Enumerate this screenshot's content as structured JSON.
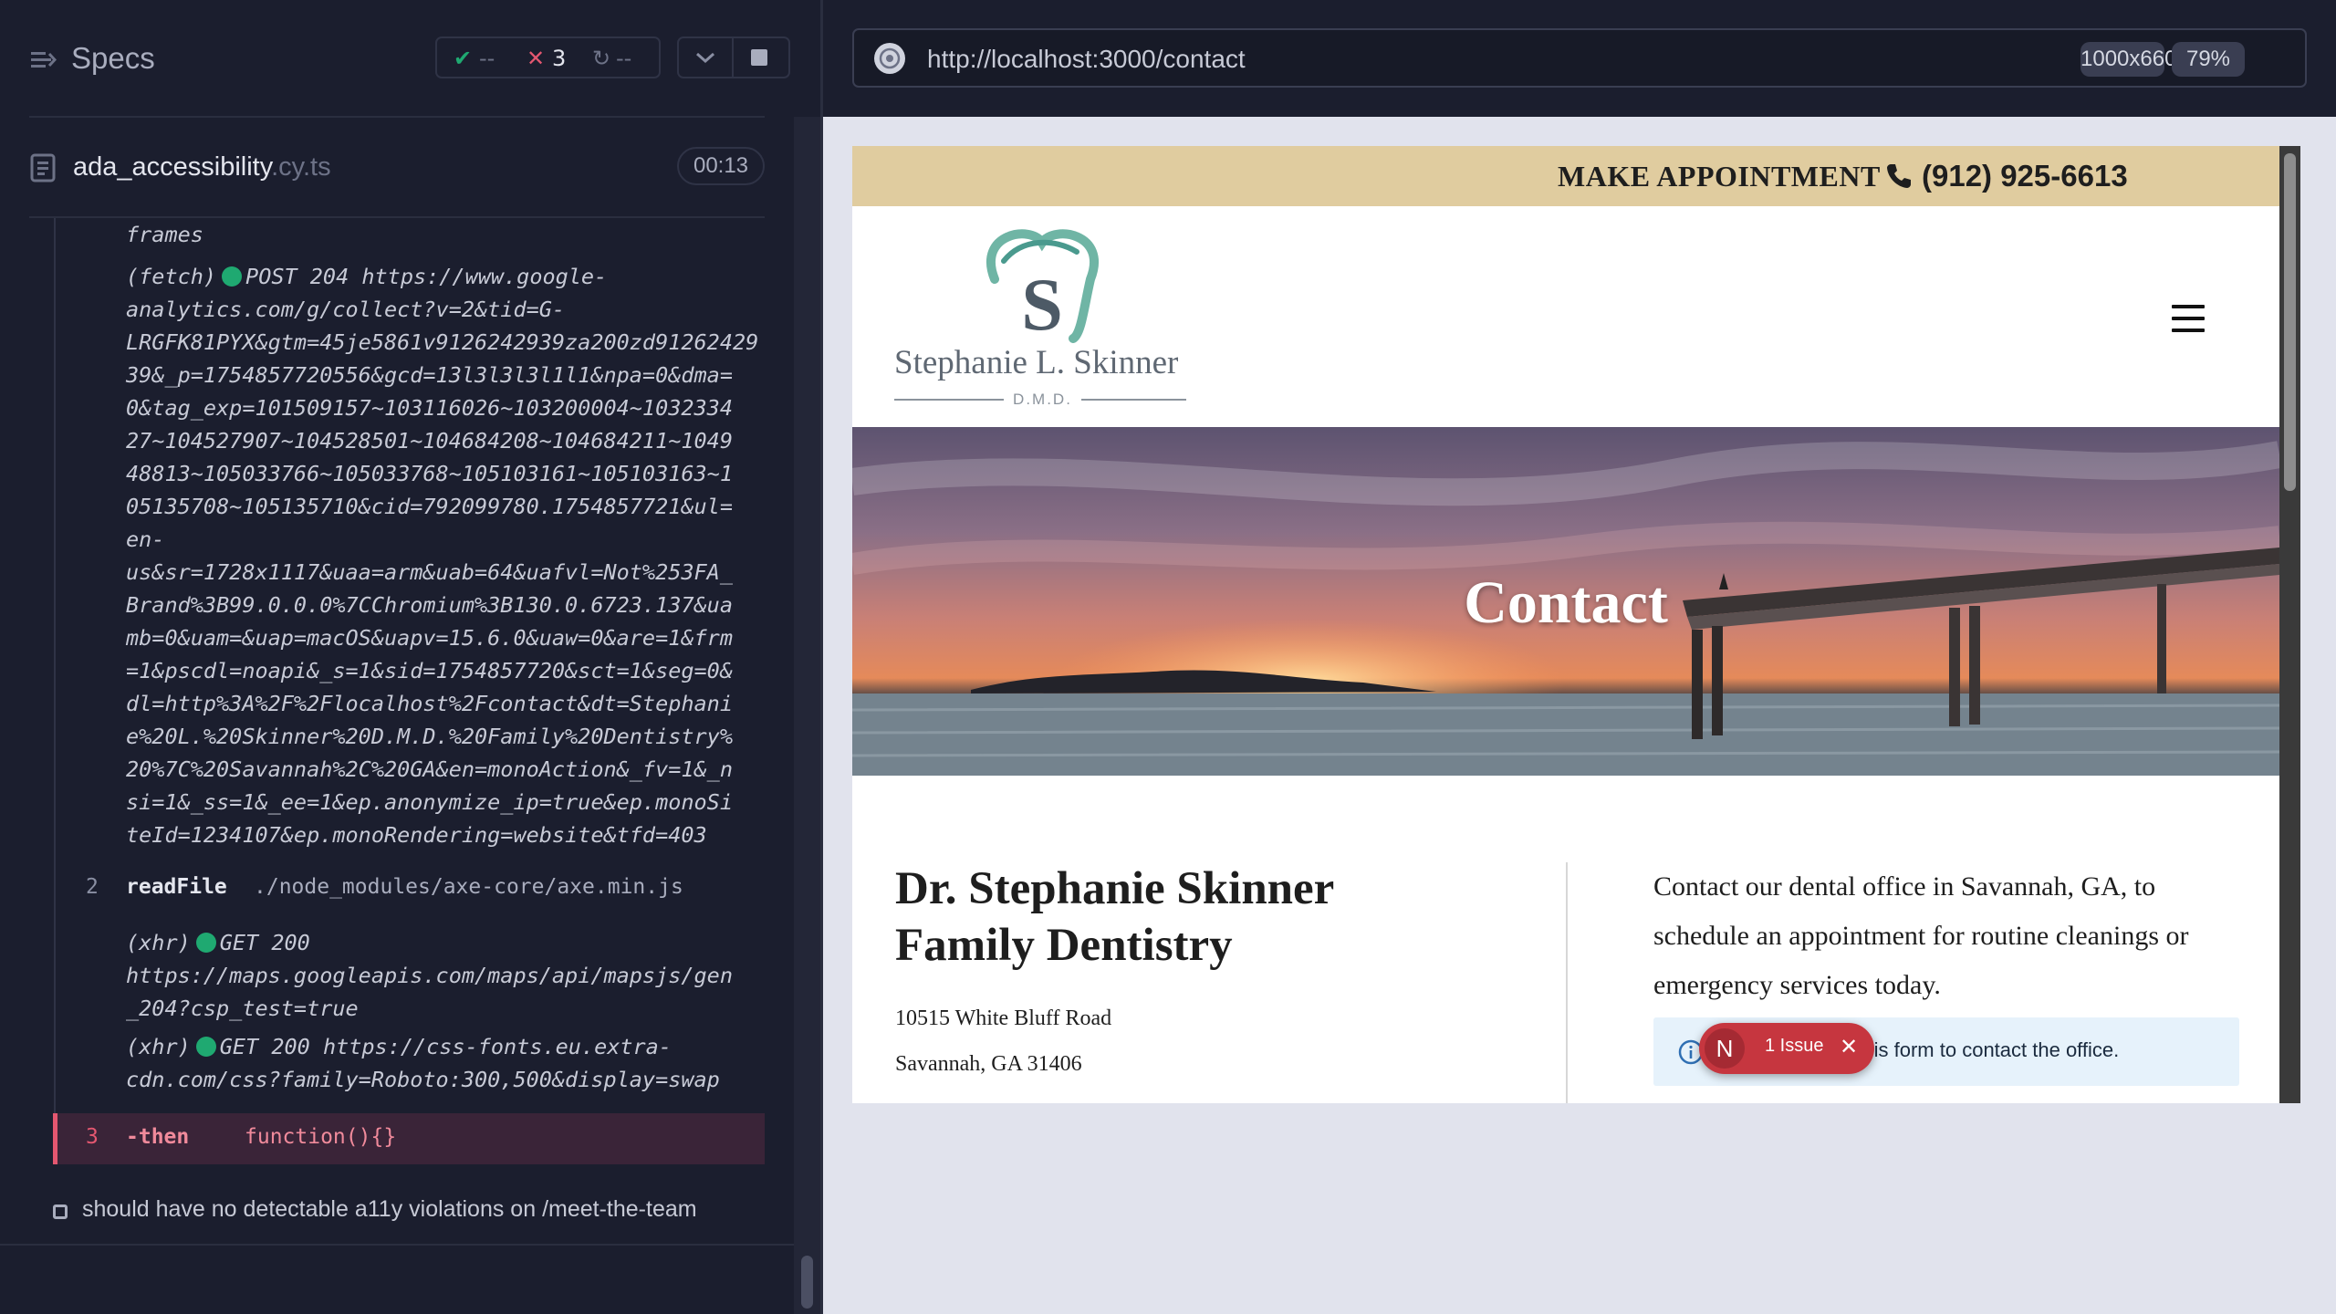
{
  "runner": {
    "specs_label": "Specs",
    "stats": {
      "passed": "--",
      "failed": "3",
      "pending": "--"
    },
    "file": {
      "name": "ada_accessibility",
      "ext": ".cy.ts",
      "duration": "00:13"
    }
  },
  "log": {
    "frames_line": "frames",
    "fetch": {
      "tag": "(fetch)",
      "method_status": "POST 204",
      "url_lines": [
        "https://www.google-",
        "analytics.com/g/collect?v=2&tid=G-",
        "LRGFK81PYX&gtm=45je5861v9126242939za200zd91262429",
        "39&_p=1754857720556&gcd=13l3l3l3l1l1&npa=0&dma=",
        "0&tag_exp=101509157~103116026~103200004~1032334",
        "27~104527907~104528501~104684208~104684211~1049",
        "48813~105033766~105033768~105103161~105103163~1",
        "05135708~105135710&cid=792099780.1754857721&ul=",
        "en-",
        "us&sr=1728x1117&uaa=arm&uab=64&uafvl=Not%253FA_",
        "Brand%3B99.0.0.0%7CChromium%3B130.0.6723.137&ua",
        "mb=0&uam=&uap=macOS&uapv=15.6.0&uaw=0&are=1&frm",
        "=1&pscdl=noapi&_s=1&sid=1754857720&sct=1&seg=0&",
        "dl=http%3A%2F%2Flocalhost%2Fcontact&dt=Stephani",
        "e%20L.%20Skinner%20D.M.D.%20Family%20Dentistry%",
        "20%7C%20Savannah%2C%20GA&en=monoAction&_fv=1&_n",
        "si=1&_ss=1&_ee=1&ep.anonymize_ip=true&ep.monoSi",
        "teId=1234107&ep.monoRendering=website&tfd=403"
      ]
    },
    "readfile": {
      "num": "2",
      "name": "readFile",
      "arg": "./node_modules/axe-core/axe.min.js"
    },
    "xhr1": {
      "tag": "(xhr)",
      "method_status": "GET 200",
      "url_lines": [
        "https://maps.googleapis.com/maps/api/mapsjs/gen",
        "_204?csp_test=true"
      ]
    },
    "xhr2": {
      "tag": "(xhr)",
      "method_status": "GET 200",
      "url_lines": [
        "https://css-fonts.eu.extra-",
        "cdn.com/css?family=Roboto:300,500&display=swap"
      ]
    },
    "then": {
      "num": "3",
      "name": "-then",
      "arg": "function(){}"
    },
    "next_test": "should have no detectable a11y violations on /meet-the-team"
  },
  "browser": {
    "url": "http://localhost:3000/contact",
    "viewport": "1000x660",
    "zoom": "79%"
  },
  "site": {
    "make_appointment": "MAKE APPOINTMENT",
    "phone": "(912) 925-6613",
    "logo_name": "Stephanie L. Skinner",
    "logo_dmd": "D.M.D.",
    "hero_title": "Contact",
    "practice_name": "Dr. Stephanie Skinner Family Dentistry",
    "address_line1": "10515 White Bluff Road",
    "address_line2": "Savannah, GA 31406",
    "contact_intro": "Contact our dental office in Savannah, GA, to schedule an appointment for routine cleanings or emergency services today.",
    "info_message": "Please submit this form to contact the office."
  },
  "issues_badge": {
    "logo_letter": "N",
    "label": "1 Issue",
    "close": "✕"
  },
  "colors": {
    "top_bar": "#e0cc9f",
    "fail_red": "#e45770",
    "pass_green": "#1fa971",
    "info_bg": "#e6f2fb"
  }
}
